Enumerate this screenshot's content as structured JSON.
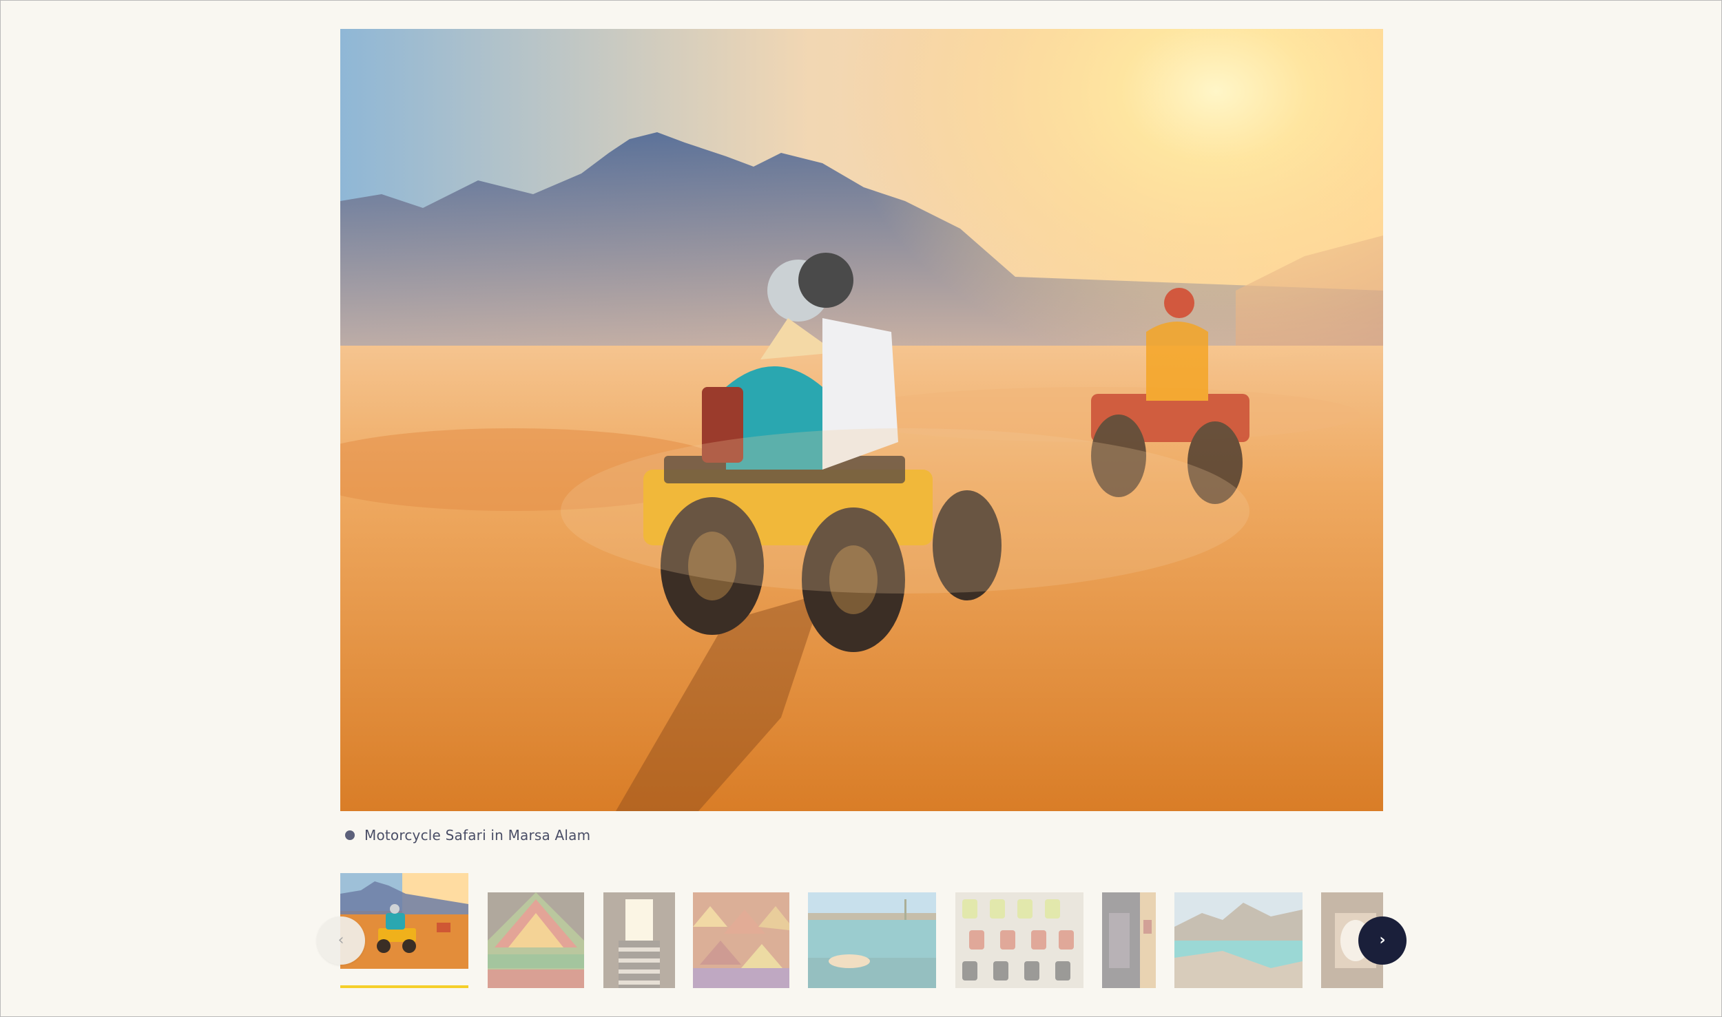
{
  "gallery": {
    "caption": "Motorcycle Safari in Marsa Alam",
    "prev_icon": "‹",
    "next_icon": "›",
    "active_index": 0,
    "thumbnails": [
      {
        "subject": "desert-quad-bike"
      },
      {
        "subject": "vegetable-market"
      },
      {
        "subject": "stone-stairway"
      },
      {
        "subject": "spice-market"
      },
      {
        "subject": "snorkeling"
      },
      {
        "subject": "perfume-bottles"
      },
      {
        "subject": "temple-corridor"
      },
      {
        "subject": "coastal-bay"
      },
      {
        "subject": "pottery"
      }
    ]
  },
  "colors": {
    "background": "#f9f7f1",
    "accent": "#f5cf2a",
    "nav_next_bg": "#1a1f3a",
    "caption_text": "#4a4e66"
  },
  "icons": {
    "prev": "chevron-left-icon",
    "next": "chevron-right-icon",
    "caption_bullet": "dot-icon"
  }
}
